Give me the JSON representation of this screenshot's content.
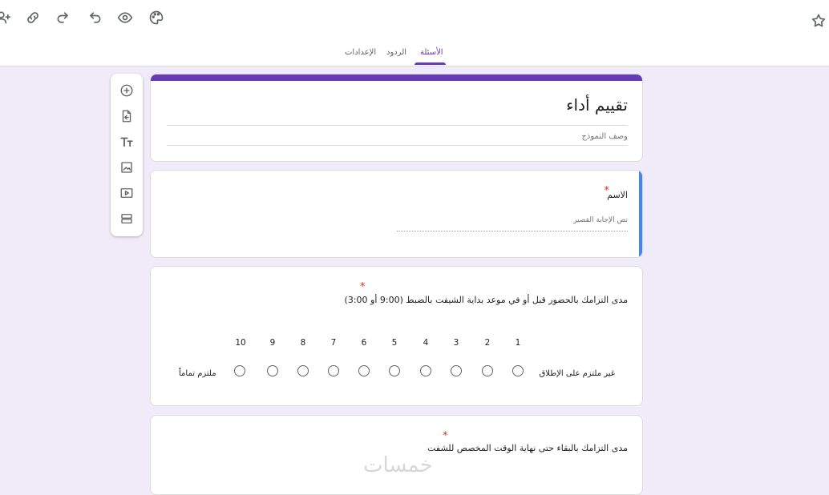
{
  "toolbar": {
    "icons": [
      "add-collaborator-icon",
      "link-icon",
      "redo-icon",
      "undo-icon",
      "preview-icon",
      "palette-icon",
      "star-icon"
    ]
  },
  "tabs": [
    {
      "label": "الأسئلة",
      "active": true
    },
    {
      "label": "الردود",
      "active": false
    },
    {
      "label": "الإعدادات",
      "active": false
    }
  ],
  "sidebar": {
    "icons": [
      "add-question-icon",
      "import-questions-icon",
      "add-title-icon",
      "add-image-icon",
      "add-video-icon",
      "add-section-icon"
    ]
  },
  "form": {
    "title": "تقييم أداء",
    "description_placeholder": "وصف النموذج"
  },
  "questions": [
    {
      "label": "الاسم",
      "required_mark": "*",
      "placeholder": "نص الإجابة القصير"
    },
    {
      "label": "مدى التزامك بالحضور قبل أو في موعد بداية الشيفت بالضبط (9:00 أو 3:00)",
      "required_mark": "*",
      "scale": [
        "1",
        "2",
        "3",
        "4",
        "5",
        "6",
        "7",
        "8",
        "9",
        "10"
      ],
      "low_label": "غير ملتزم على الإطلاق",
      "high_label": "ملتزم تماماً"
    },
    {
      "label": "مدى التزامك بالبقاء حتى نهاية الوقت المخصص للشفت",
      "required_mark": "*"
    }
  ],
  "watermark": "خمسات",
  "colors": {
    "accent": "#673ab7",
    "focus": "#4285f4",
    "required": "#d93025",
    "background": "#f0ebf8"
  }
}
